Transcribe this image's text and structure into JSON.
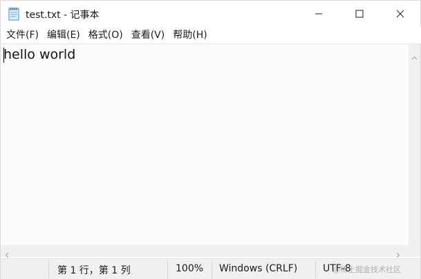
{
  "window": {
    "title": "test.txt - 记事本",
    "app_icon": "notepad-icon"
  },
  "menu": {
    "items": [
      {
        "label": "文件(F)"
      },
      {
        "label": "编辑(E)"
      },
      {
        "label": "格式(O)"
      },
      {
        "label": "查看(V)"
      },
      {
        "label": "帮助(H)"
      }
    ]
  },
  "editor": {
    "content": "hello world"
  },
  "status": {
    "position": "第 1 行，第 1 列",
    "zoom": "100%",
    "line_ending": "Windows (CRLF)",
    "encoding": "UTF-8",
    "watermark": "@稀土掘金技术社区"
  },
  "icons": {
    "minimize": "minimize-icon",
    "maximize": "maximize-icon",
    "close": "close-icon",
    "scroll_up": "chevron-up-icon",
    "scroll_left": "chevron-left-icon",
    "scroll_right": "chevron-right-icon"
  }
}
